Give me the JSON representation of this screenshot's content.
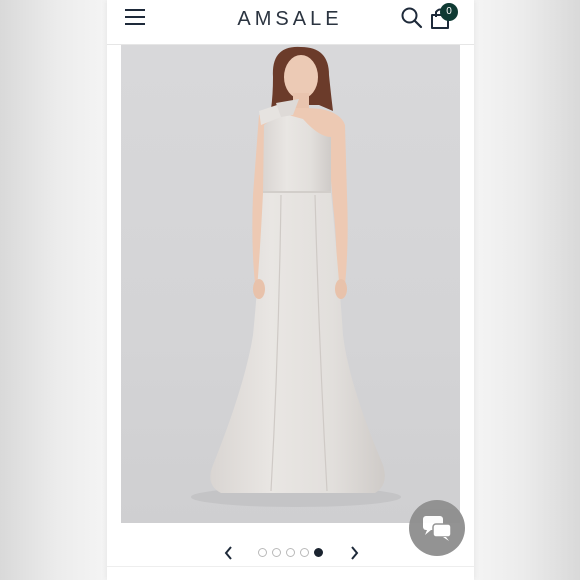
{
  "header": {
    "brand": "AMSALE",
    "cart_count": "0",
    "menu_icon": "hamburger-menu-icon",
    "search_icon": "search-icon",
    "cart_icon": "shopping-bag-icon"
  },
  "carousel": {
    "total_slides": 5,
    "active_slide": 5,
    "prev_icon": "chevron-left-icon",
    "next_icon": "chevron-right-icon"
  },
  "chat": {
    "icon": "chat-bubbles-icon"
  },
  "colors": {
    "accent": "#0f3a33",
    "text_dark": "#1e2a3a",
    "photo_background": "#d6d6d8",
    "dress": "#e4e1de",
    "chat_button": "#8e8e8e"
  }
}
